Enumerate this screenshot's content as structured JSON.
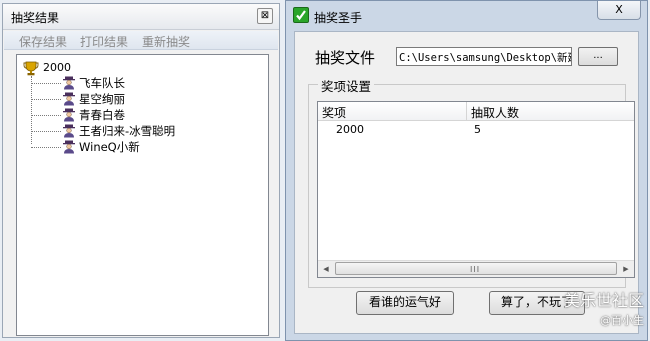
{
  "left_window": {
    "title": "抽奖结果",
    "close_glyph": "⊠",
    "menu": [
      "保存结果",
      "打印结果",
      "重新抽奖"
    ],
    "tree": {
      "root_label": "2000",
      "root_icon": "trophy-icon",
      "children_icon": "person-icon",
      "children": [
        "飞车队长",
        "星空绚丽",
        "青春白卷",
        "王者归来-冰雪聪明",
        "WineQ小新"
      ]
    }
  },
  "right_window": {
    "title": "抽奖圣手",
    "close_label": "X",
    "file_label": "抽奖文件",
    "file_path": "C:\\Users\\samsung\\Desktop\\新建",
    "browse_label": "...",
    "group_title": "奖项设置",
    "list": {
      "columns": [
        "奖项",
        "抽取人数"
      ],
      "rows": [
        [
          "2000",
          "5"
        ]
      ]
    },
    "scrollbar_grip": "III",
    "buttons": {
      "draw": "看谁的运气好",
      "quit": "算了，不玩了"
    }
  },
  "watermark": {
    "line1": "美乐世社区",
    "line2": "@百小生"
  },
  "colors": {
    "desktop": "#e9eef4",
    "window_frame": "#cbd7e6",
    "app_icon_green": "#2aa52a"
  }
}
